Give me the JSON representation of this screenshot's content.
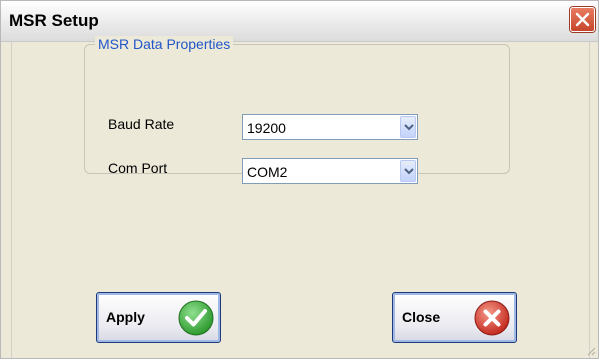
{
  "window": {
    "title": "MSR Setup"
  },
  "group": {
    "legend": "MSR Data Properties"
  },
  "baud": {
    "label": "Baud Rate",
    "value": "19200"
  },
  "com": {
    "label": "Com Port",
    "value": "COM2"
  },
  "buttons": {
    "apply": "Apply",
    "close": "Close"
  },
  "icons": {
    "title_close": "close-icon",
    "dropdown": "chevron-down-icon",
    "apply": "check-icon",
    "close": "x-circle-icon"
  },
  "colors": {
    "legend": "#2156c9",
    "check": "#3fae3f",
    "close": "#d23a2a"
  }
}
